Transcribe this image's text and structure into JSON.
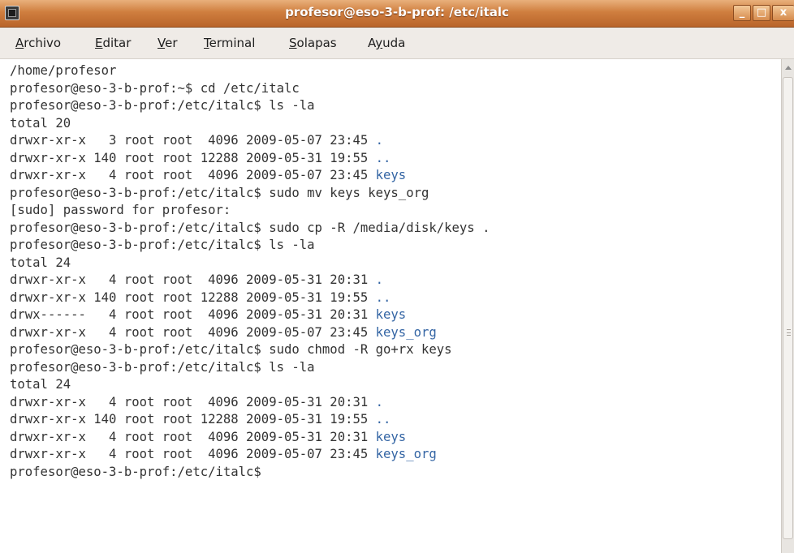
{
  "window": {
    "title": "profesor@eso-3-b-prof: /etc/italc",
    "buttons": {
      "minimize": "_",
      "maximize": "□",
      "close": "x"
    }
  },
  "menubar": {
    "items": [
      {
        "mnemonic": "A",
        "rest": "rchivo"
      },
      {
        "mnemonic": "E",
        "rest": "ditar"
      },
      {
        "mnemonic": "V",
        "rest": "er"
      },
      {
        "mnemonic": "T",
        "rest": "erminal"
      },
      {
        "mnemonic": "S",
        "rest": "olapas"
      },
      {
        "pre": "A",
        "mnemonic": "y",
        "rest": "uda"
      }
    ]
  },
  "terminal": {
    "colors": {
      "text": "#333333",
      "directory": "#3465a4"
    },
    "lines": [
      {
        "text": "/home/profesor"
      },
      {
        "text": "profesor@eso-3-b-prof:~$ cd /etc/italc"
      },
      {
        "text": "profesor@eso-3-b-prof:/etc/italc$ ls -la"
      },
      {
        "text": "total 20"
      },
      {
        "text": "drwxr-xr-x   3 root root  4096 2009-05-07 23:45 ",
        "entry": "."
      },
      {
        "text": "drwxr-xr-x 140 root root 12288 2009-05-31 19:55 ",
        "entry": ".."
      },
      {
        "text": "drwxr-xr-x   4 root root  4096 2009-05-07 23:45 ",
        "entry": "keys"
      },
      {
        "text": "profesor@eso-3-b-prof:/etc/italc$ sudo mv keys keys_org"
      },
      {
        "text": "[sudo] password for profesor:"
      },
      {
        "text": "profesor@eso-3-b-prof:/etc/italc$ sudo cp -R /media/disk/keys ."
      },
      {
        "text": "profesor@eso-3-b-prof:/etc/italc$ ls -la"
      },
      {
        "text": "total 24"
      },
      {
        "text": "drwxr-xr-x   4 root root  4096 2009-05-31 20:31 ",
        "entry": "."
      },
      {
        "text": "drwxr-xr-x 140 root root 12288 2009-05-31 19:55 ",
        "entry": ".."
      },
      {
        "text": "drwx------   4 root root  4096 2009-05-31 20:31 ",
        "entry": "keys"
      },
      {
        "text": "drwxr-xr-x   4 root root  4096 2009-05-07 23:45 ",
        "entry": "keys_org"
      },
      {
        "text": "profesor@eso-3-b-prof:/etc/italc$ sudo chmod -R go+rx keys"
      },
      {
        "text": "profesor@eso-3-b-prof:/etc/italc$ ls -la"
      },
      {
        "text": "total 24"
      },
      {
        "text": "drwxr-xr-x   4 root root  4096 2009-05-31 20:31 ",
        "entry": "."
      },
      {
        "text": "drwxr-xr-x 140 root root 12288 2009-05-31 19:55 ",
        "entry": ".."
      },
      {
        "text": "drwxr-xr-x   4 root root  4096 2009-05-31 20:31 ",
        "entry": "keys"
      },
      {
        "text": "drwxr-xr-x   4 root root  4096 2009-05-07 23:45 ",
        "entry": "keys_org"
      },
      {
        "text": "profesor@eso-3-b-prof:/etc/italc$"
      }
    ]
  }
}
